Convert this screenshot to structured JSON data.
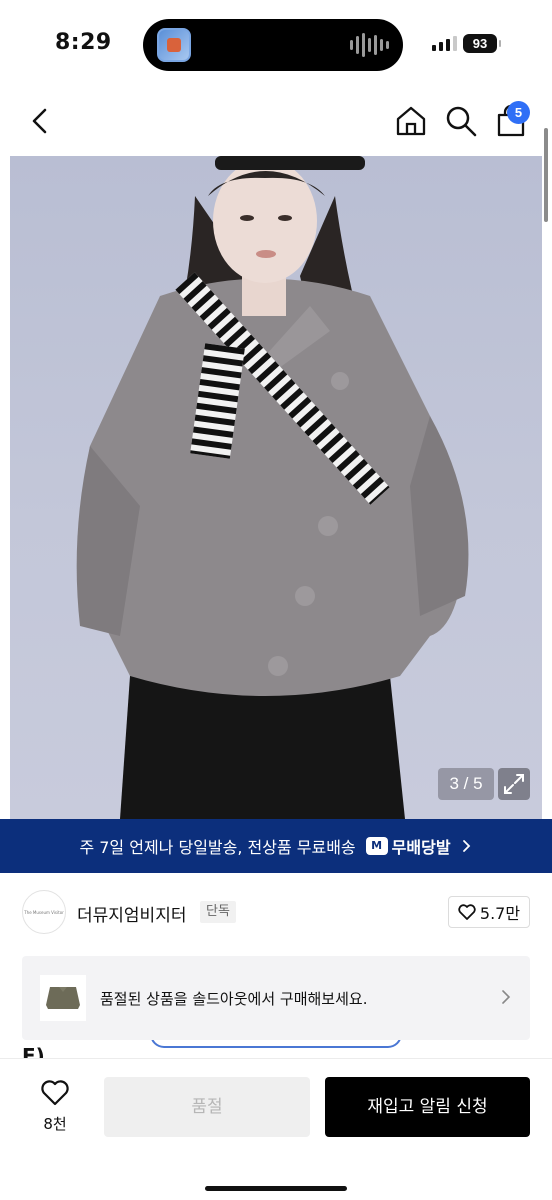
{
  "status_bar": {
    "time": "8:29",
    "battery": "93"
  },
  "nav": {
    "cart_count": "5"
  },
  "gallery": {
    "counter": "3 / 5"
  },
  "banner": {
    "text": "주 7일 언제나 당일발송, 전상품 무료배송",
    "brand": "무배당발",
    "badge": "M"
  },
  "brand": {
    "logo_text": "The Museum Visitor",
    "name": "더뮤지엄비지터",
    "tag": "단독",
    "likes": "5.7만"
  },
  "soldout_card": {
    "text": "품절된 상품을 솔드아웃에서 구매해보세요."
  },
  "behind": {
    "text": "F)"
  },
  "bottom_bar": {
    "wish_count": "8천",
    "soldout_label": "품절",
    "restock_label": "재입고 알림 신청"
  },
  "colors": {
    "banner": "#0c2f7c",
    "badge": "#2f6ff6",
    "primary_button": "#000000"
  }
}
